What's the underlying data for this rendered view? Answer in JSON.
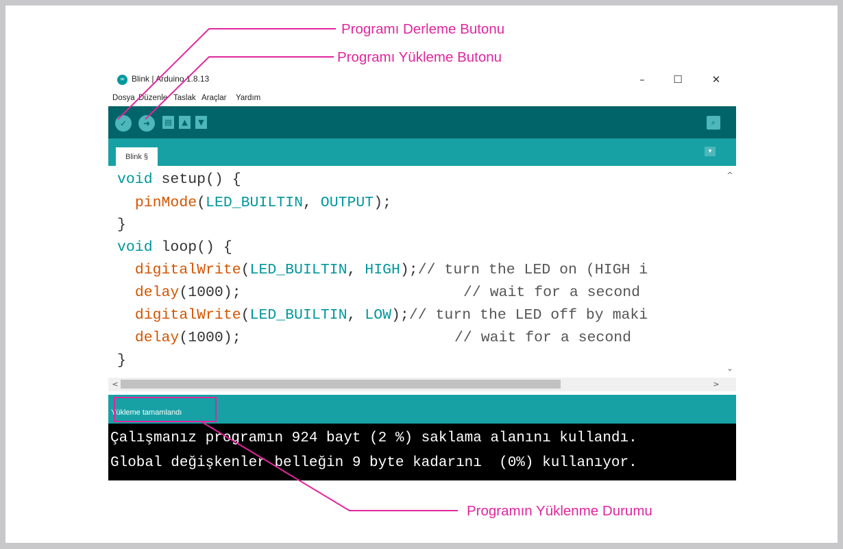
{
  "window": {
    "title": "Blink | Arduino 1.8.13",
    "app_icon_glyph": "∞",
    "controls": {
      "minimize": "–",
      "maximize": "☐",
      "close": "✕"
    }
  },
  "menu": [
    "Dosya",
    "Düzenle",
    "Taslak",
    "Araçlar",
    "Yardım"
  ],
  "toolbar": {
    "verify_glyph": "✓",
    "upload_glyph": "➜",
    "new_glyph": "▤",
    "open_glyph": "▲",
    "save_glyph": "▼",
    "serial_monitor_glyph": "⌕"
  },
  "tab": {
    "label": "Blink §",
    "menu_glyph": "▾"
  },
  "code": {
    "line1": {
      "kw": "void",
      "rest": " setup() {"
    },
    "line2": {
      "fn": "pinMode",
      "p1": "(",
      "a1": "LED_BUILTIN",
      "p2": ", ",
      "a2": "OUTPUT",
      "p3": ");"
    },
    "line3": "}",
    "line4": {
      "kw": "void",
      "rest": " loop() {"
    },
    "line5": {
      "fn": "digitalWrite",
      "p1": "(",
      "a1": "LED_BUILTIN",
      "p2": ", ",
      "a2": "HIGH",
      "p3": ");",
      "comment": "// turn the LED on (HIGH i"
    },
    "line6": {
      "fn": "delay",
      "p1": "(1000);",
      "comment": "// wait for a second"
    },
    "line7": {
      "fn": "digitalWrite",
      "p1": "(",
      "a1": "LED_BUILTIN",
      "p2": ", ",
      "a2": "LOW",
      "p3": ");",
      "comment": "// turn the LED off by maki"
    },
    "line8": {
      "fn": "delay",
      "p1": "(1000);",
      "comment": "// wait for a second"
    },
    "line9": "}"
  },
  "scroll": {
    "up": "^",
    "down": "⌄",
    "left": "<",
    "right": ">"
  },
  "status": {
    "text": "Yükleme tamamlandı"
  },
  "console": {
    "line1": "Çalışmanız programın 924 bayt (2 %) saklama alanını kullandı.",
    "line2": "Global değişkenler belleğin 9 byte kadarını  (0%) kullanıyor."
  },
  "annotations": {
    "verify": "Programı Derleme Butonu",
    "upload": "Programı Yükleme Butonu",
    "status": "Programın Yüklenme Durumu",
    "color": "#e0269c"
  },
  "colors": {
    "toolbar": "#006468",
    "tabbar": "#17a1a5",
    "button": "#4db7bb",
    "keyword": "#00979c",
    "function": "#d35400"
  }
}
